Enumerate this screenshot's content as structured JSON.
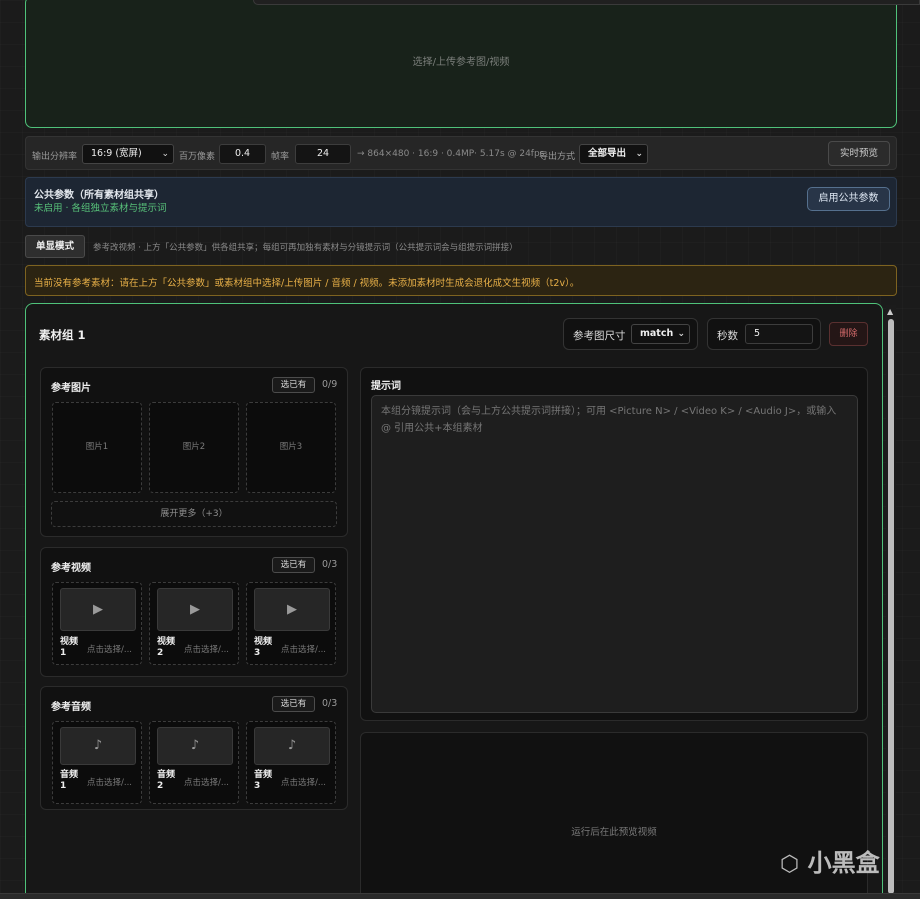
{
  "upload": {
    "hint": "选择/上传参考图/视频"
  },
  "output_bar": {
    "resolution_label": "输出分辨率",
    "resolution_value": "16:9 (宽屏)",
    "megapixel_label": "百万像素",
    "megapixel_value": "0.4",
    "fps_label": "帧率",
    "fps_value": "24",
    "summary": "→ 864×480 · 16:9 · 0.4MP· 5.17s @ 24fps",
    "export_label": "导出方式",
    "export_value": "全部导出",
    "preview_button": "实时预览"
  },
  "common_params": {
    "title": "公共参数（所有素材组共享）",
    "status": "未启用 · 各组独立素材与提示词",
    "enable_button": "启用公共参数"
  },
  "mode": {
    "button": "单显模式",
    "description": "参考改视频 · 上方「公共参数」供各组共享；每组可再加独有素材与分镜提示词（公共提示词会与组提示词拼接）"
  },
  "warning": "当前没有参考素材：请在上方「公共参数」或素材组中选择/上传图片 / 音频 / 视频。未添加素材时生成会退化成文生视频（t2v）。",
  "group": {
    "title": "素材组 1",
    "ref_size_label": "参考图尺寸",
    "ref_size_value": "match",
    "seconds_label": "秒数",
    "seconds_value": "5",
    "delete_button": "删除",
    "images": {
      "title": "参考图片",
      "pick_button": "选已有",
      "count": "0/9",
      "slots": [
        "图片1",
        "图片2",
        "图片3"
      ],
      "expand": "展开更多（+3）"
    },
    "videos": {
      "title": "参考视频",
      "pick_button": "选已有",
      "count": "0/3",
      "items": [
        {
          "name": "视频 1",
          "hint": "点击选择/..."
        },
        {
          "name": "视频 2",
          "hint": "点击选择/..."
        },
        {
          "name": "视频 3",
          "hint": "点击选择/..."
        }
      ]
    },
    "audios": {
      "title": "参考音频",
      "pick_button": "选已有",
      "count": "0/3",
      "items": [
        {
          "name": "音频 1",
          "hint": "点击选择/..."
        },
        {
          "name": "音频 2",
          "hint": "点击选择/..."
        },
        {
          "name": "音频 3",
          "hint": "点击选择/..."
        }
      ]
    },
    "prompt": {
      "title": "提示词",
      "placeholder": "本组分镜提示词（会与上方公共提示词拼接）；可用 <Picture N> / <Video K> / <Audio J>，或输入 @ 引用公共+本组素材"
    },
    "preview_hint": "运行后在此预览视频"
  },
  "watermark": "小黑盒",
  "colors": {
    "accent_green": "#4fc27a",
    "warning": "#e8b048",
    "delete": "#d36a6a"
  },
  "icons": {
    "video": "play-icon",
    "audio": "music-note-icon",
    "watermark": "heybox-logo-icon"
  }
}
